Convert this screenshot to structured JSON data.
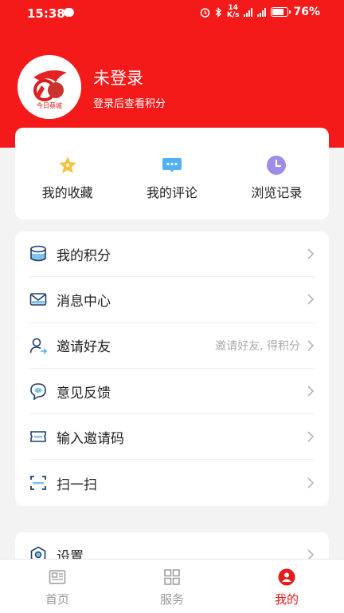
{
  "status_bar": {
    "time": "15:38",
    "net_speed_top": "14",
    "net_speed_bottom": "K/s",
    "battery": "76%"
  },
  "profile": {
    "logo_text": "今日蔡城",
    "name": "未登录",
    "subtitle": "登录后查看积分"
  },
  "quick_actions": [
    {
      "label": "我的收藏",
      "icon": "star-icon"
    },
    {
      "label": "我的评论",
      "icon": "comment-icon"
    },
    {
      "label": "浏览记录",
      "icon": "clock-icon"
    }
  ],
  "menu": [
    {
      "label": "我的积分",
      "icon": "coins-icon",
      "hint": ""
    },
    {
      "label": "消息中心",
      "icon": "mail-icon",
      "hint": ""
    },
    {
      "label": "邀请好友",
      "icon": "invite-user-icon",
      "hint": "邀请好友, 得积分"
    },
    {
      "label": "意见反馈",
      "icon": "feedback-icon",
      "hint": ""
    },
    {
      "label": "输入邀请码",
      "icon": "ticket-icon",
      "hint": ""
    },
    {
      "label": "扫一扫",
      "icon": "scan-icon",
      "hint": ""
    }
  ],
  "settings": {
    "label": "设置",
    "icon": "gear-icon"
  },
  "bottom_nav": [
    {
      "label": "首页",
      "icon": "news-icon"
    },
    {
      "label": "服务",
      "icon": "grid-icon"
    },
    {
      "label": "我的",
      "icon": "profile-icon"
    }
  ],
  "colors": {
    "brand_red": "#f41a1a",
    "active_red": "#e51c1c"
  }
}
